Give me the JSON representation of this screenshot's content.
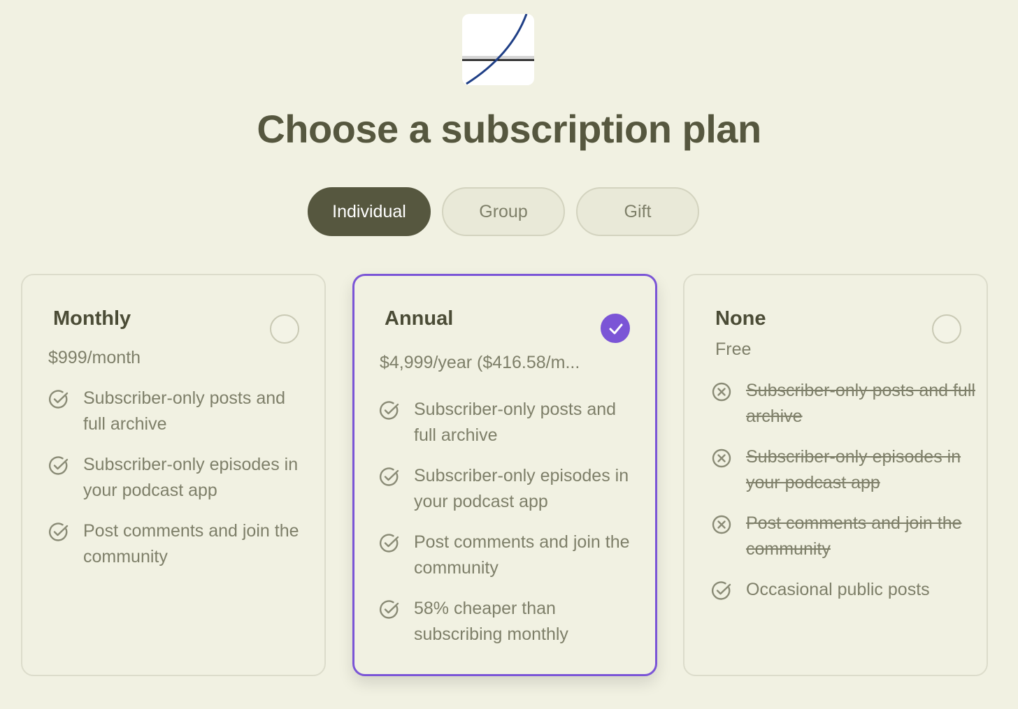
{
  "logo": {
    "icon": "curve-chart-logo-icon"
  },
  "title": "Choose a subscription plan",
  "tabs": [
    {
      "label": "Individual",
      "active": true
    },
    {
      "label": "Group",
      "active": false
    },
    {
      "label": "Gift",
      "active": false
    }
  ],
  "colors": {
    "accent": "#7b55d6",
    "background": "#f1f1e2",
    "text": "#56573f"
  },
  "plans": [
    {
      "name": "Monthly",
      "price": "$999/month",
      "selected": false,
      "features": [
        {
          "text": "Subscriber-only posts and full archive",
          "included": true
        },
        {
          "text": "Subscriber-only episodes in your podcast app",
          "included": true
        },
        {
          "text": "Post comments and join the community",
          "included": true
        }
      ]
    },
    {
      "name": "Annual",
      "price": "$4,999/year ($416.58/m...",
      "selected": true,
      "features": [
        {
          "text": "Subscriber-only posts and full archive",
          "included": true
        },
        {
          "text": "Subscriber-only episodes in your podcast app",
          "included": true
        },
        {
          "text": "Post comments and join the community",
          "included": true
        },
        {
          "text": "58% cheaper than subscribing monthly",
          "included": true
        }
      ]
    },
    {
      "name": "None",
      "price": "Free",
      "selected": false,
      "features": [
        {
          "text": "Subscriber-only posts and full archive",
          "included": false
        },
        {
          "text": "Subscriber-only episodes in your podcast app",
          "included": false
        },
        {
          "text": "Post comments and join the community",
          "included": false
        },
        {
          "text": "Occasional public posts",
          "included": true
        }
      ]
    }
  ]
}
